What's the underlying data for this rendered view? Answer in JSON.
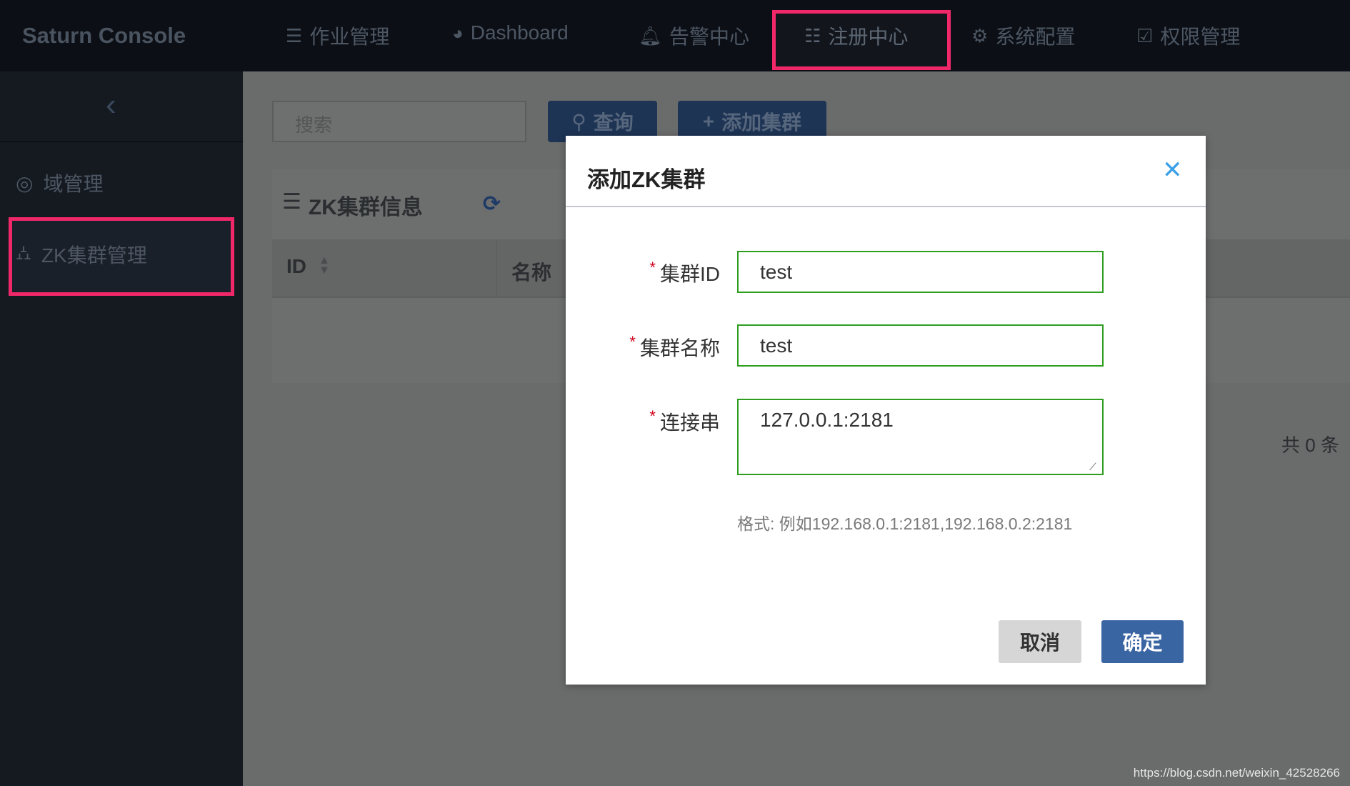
{
  "app": {
    "title": "Saturn Console"
  },
  "nav": [
    {
      "label": "作业管理",
      "icon": "list-icon"
    },
    {
      "label": "Dashboard",
      "icon": "pie-chart-icon"
    },
    {
      "label": "告警中心",
      "icon": "bell-icon"
    },
    {
      "label": "注册中心",
      "icon": "server-icon",
      "active": true
    },
    {
      "label": "系统配置",
      "icon": "gear-icon"
    },
    {
      "label": "权限管理",
      "icon": "check-square-icon"
    }
  ],
  "sidebar": {
    "items": [
      {
        "label": "域管理",
        "icon": "support-icon"
      },
      {
        "label": "ZK集群管理",
        "icon": "sitemap-icon",
        "active": true
      }
    ]
  },
  "toolbar": {
    "search_placeholder": "搜索",
    "query": "查询",
    "add": "添加集群"
  },
  "card": {
    "title": "ZK集群信息",
    "columns": [
      "ID",
      "名称"
    ],
    "total": "共 0 条"
  },
  "modal": {
    "title": "添加ZK集群",
    "fields": [
      {
        "label": "集群ID",
        "value": "test"
      },
      {
        "label": "集群名称",
        "value": "test"
      },
      {
        "label": "连接串",
        "value": "127.0.0.1:2181"
      }
    ],
    "hint": "格式: 例如192.168.0.1:2181,192.168.0.2:2181",
    "cancel": "取消",
    "confirm": "确定"
  },
  "watermark": "https://blog.csdn.net/weixin_42528266",
  "colors": {
    "highlight": "#f0286a",
    "primary": "#3a65a3",
    "valid": "#2e9e1f"
  }
}
